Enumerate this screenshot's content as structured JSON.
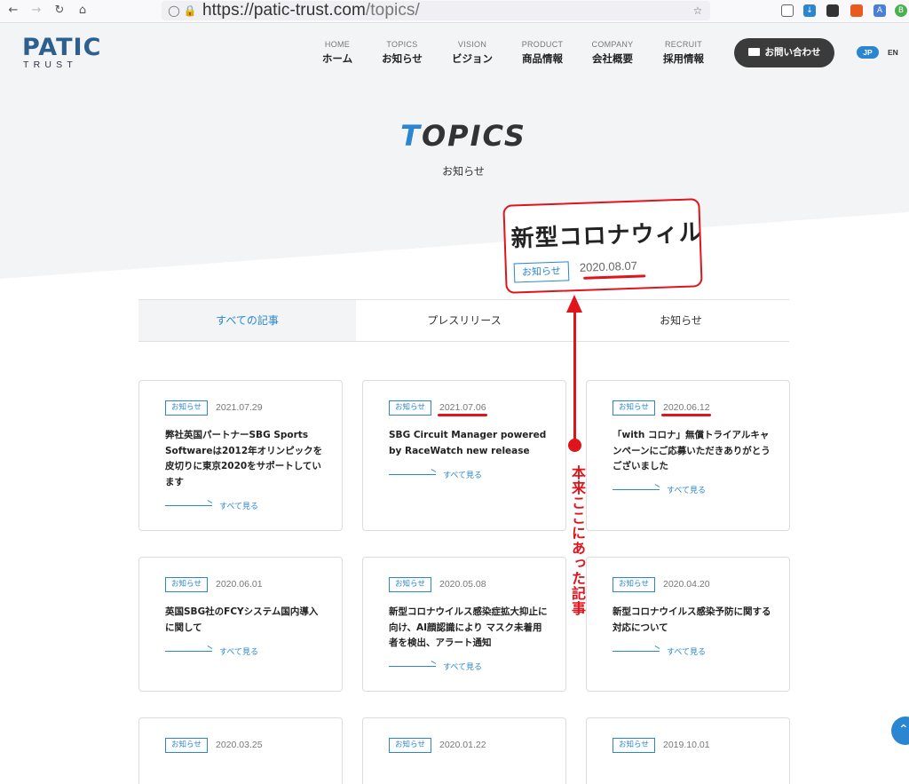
{
  "browser": {
    "url_main": "https://patic-trust.com",
    "url_path": "/topics/"
  },
  "logo": {
    "top": "PATIC",
    "bottom": "TRUST"
  },
  "nav": [
    {
      "en": "HOME",
      "ja": "ホーム"
    },
    {
      "en": "TOPICS",
      "ja": "お知らせ"
    },
    {
      "en": "VISION",
      "ja": "ビジョン"
    },
    {
      "en": "PRODUCT",
      "ja": "商品情報"
    },
    {
      "en": "COMPANY",
      "ja": "会社概要"
    },
    {
      "en": "RECRUIT",
      "ja": "採用情報"
    }
  ],
  "contact_label": "お問い合わせ",
  "lang": {
    "jp": "JP",
    "en": "EN"
  },
  "hero": {
    "title_first": "T",
    "title_rest": "OPICS",
    "subtitle": "お知らせ"
  },
  "tabs": [
    "すべての記事",
    "プレスリリース",
    "お知らせ"
  ],
  "cards": [
    {
      "badge": "お知らせ",
      "date": "2021.07.29",
      "title": "弊社英国パートナーSBG Sports Softwareは2012年オリンピックを皮切りに東京2020をサポートしています",
      "more": "すべて見る"
    },
    {
      "badge": "お知らせ",
      "date": "2021.07.06",
      "title": "SBG Circuit Manager powered by RaceWatch new release",
      "more": "すべて見る"
    },
    {
      "badge": "お知らせ",
      "date": "2020.06.12",
      "title": "「with コロナ」無償トライアルキャンペーンにご応募いただきありがとうございました",
      "more": "すべて見る"
    },
    {
      "badge": "お知らせ",
      "date": "2020.06.01",
      "title": "英国SBG社のFCYシステム国内導入に関して",
      "more": "すべて見る"
    },
    {
      "badge": "お知らせ",
      "date": "2020.05.08",
      "title": "新型コロナウイルス感染症拡大抑止に向け、AI顔認識により マスク未着用者を検出、アラート通知",
      "more": "すべて見る"
    },
    {
      "badge": "お知らせ",
      "date": "2020.04.20",
      "title": "新型コロナウイルス感染予防に関する対応について",
      "more": "すべて見る"
    },
    {
      "badge": "お知らせ",
      "date": "2020.03.25",
      "title": "",
      "more": ""
    },
    {
      "badge": "お知らせ",
      "date": "2020.01.22",
      "title": "",
      "more": ""
    },
    {
      "badge": "お知らせ",
      "date": "2019.10.01",
      "title": "",
      "more": ""
    }
  ],
  "annotation": {
    "snippet_title": "新型コロナウィルス",
    "snippet_badge": "お知らせ",
    "snippet_date": "2020.08.07",
    "note": "本来ここにあった記事"
  },
  "colors": {
    "accent": "#2a86d0",
    "annotation": "#e0141b",
    "header_bg": "#f3f4f5"
  }
}
